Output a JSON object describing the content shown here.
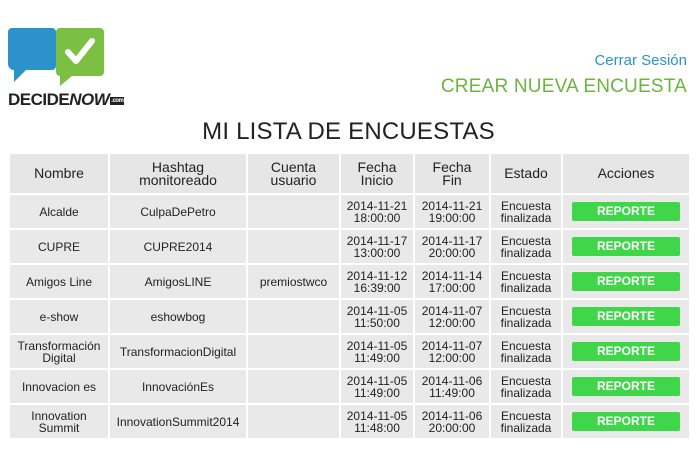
{
  "brand": {
    "logo_text_main": "DECIDE",
    "logo_text_accent": "NOW",
    "logo_text_suffix": ".com",
    "colors": {
      "blue": "#2b93c9",
      "green": "#6cb33f",
      "button": "#3fd64a"
    }
  },
  "header": {
    "logout_label": "Cerrar Sesión",
    "create_label": "CREAR NUEVA ENCUESTA"
  },
  "page": {
    "title": "MI LISTA DE ENCUESTAS"
  },
  "table": {
    "headers": {
      "name": "Nombre",
      "hashtag_1": "Hashtag",
      "hashtag_2": "monitoreado",
      "account_1": "Cuenta",
      "account_2": "usuario",
      "start_1": "Fecha",
      "start_2": "Inicio",
      "end_1": "Fecha",
      "end_2": "Fin",
      "status": "Estado",
      "actions": "Acciones"
    },
    "rows": [
      {
        "name_1": "Alcalde",
        "name_2": "",
        "hashtag": "CulpaDePetro",
        "account": "",
        "start_date": "2014-11-21",
        "start_time": "18:00:00",
        "end_date": "2014-11-21",
        "end_time": "19:00:00",
        "status_1": "Encuesta",
        "status_2": "finalizada",
        "action": "REPORTE"
      },
      {
        "name_1": "CUPRE",
        "name_2": "",
        "hashtag": "CUPRE2014",
        "account": "",
        "start_date": "2014-11-17",
        "start_time": "13:00:00",
        "end_date": "2014-11-17",
        "end_time": "20:00:00",
        "status_1": "Encuesta",
        "status_2": "finalizada",
        "action": "REPORTE"
      },
      {
        "name_1": "Amigos Line",
        "name_2": "",
        "hashtag": "AmigosLINE",
        "account": "premiostwco",
        "start_date": "2014-11-12",
        "start_time": "16:39:00",
        "end_date": "2014-11-14",
        "end_time": "17:00:00",
        "status_1": "Encuesta",
        "status_2": "finalizada",
        "action": "REPORTE"
      },
      {
        "name_1": "e-show",
        "name_2": "",
        "hashtag": "eshowbog",
        "account": "",
        "start_date": "2014-11-05",
        "start_time": "11:50:00",
        "end_date": "2014-11-07",
        "end_time": "12:00:00",
        "status_1": "Encuesta",
        "status_2": "finalizada",
        "action": "REPORTE"
      },
      {
        "name_1": "Transformación",
        "name_2": "Digital",
        "hashtag": "TransformacionDigital",
        "account": "",
        "start_date": "2014-11-05",
        "start_time": "11:49:00",
        "end_date": "2014-11-07",
        "end_time": "12:00:00",
        "status_1": "Encuesta",
        "status_2": "finalizada",
        "action": "REPORTE"
      },
      {
        "name_1": "Innovacion es",
        "name_2": "",
        "hashtag": "InnovaciónEs",
        "account": "",
        "start_date": "2014-11-05",
        "start_time": "11:49:00",
        "end_date": "2014-11-06",
        "end_time": "11:49:00",
        "status_1": "Encuesta",
        "status_2": "finalizada",
        "action": "REPORTE"
      },
      {
        "name_1": "Innovation",
        "name_2": "Summit",
        "hashtag": "InnovationSummit2014",
        "account": "",
        "start_date": "2014-11-05",
        "start_time": "11:48:00",
        "end_date": "2014-11-06",
        "end_time": "20:00:00",
        "status_1": "Encuesta",
        "status_2": "finalizada",
        "action": "REPORTE"
      }
    ]
  }
}
